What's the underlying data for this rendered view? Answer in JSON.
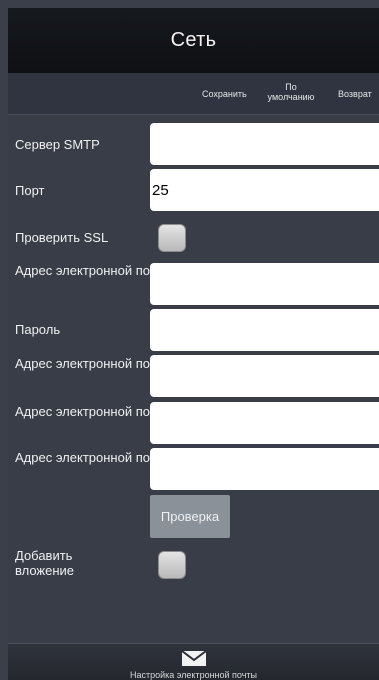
{
  "header": {
    "title": "Сеть"
  },
  "actions": {
    "save": "Сохранить",
    "default": "По умолчанию",
    "back": "Возврат"
  },
  "form": {
    "smtp_server": {
      "label": "Сервер SMTP",
      "value": ""
    },
    "port": {
      "label": "Порт",
      "value": "25"
    },
    "check_ssl": {
      "label": "Проверить SSL",
      "checked": false
    },
    "sender_email": {
      "label": "Адрес электронной почты для отправки",
      "value": ""
    },
    "password": {
      "label": "Пароль",
      "value": ""
    },
    "recipient_email_1": {
      "label": "Адрес электронной почты для получения",
      "value": ""
    },
    "recipient_email_2": {
      "label": "Адрес электронной почты для получения",
      "value": ""
    },
    "recipient_email_3": {
      "label": "Адрес электронной почты для получения",
      "value": ""
    },
    "test_button": "Проверка",
    "add_attachment": {
      "label": "Добавить вложение",
      "checked": false
    }
  },
  "footer": {
    "caption": "Настройка электронной почты",
    "icon": "mail-icon"
  }
}
